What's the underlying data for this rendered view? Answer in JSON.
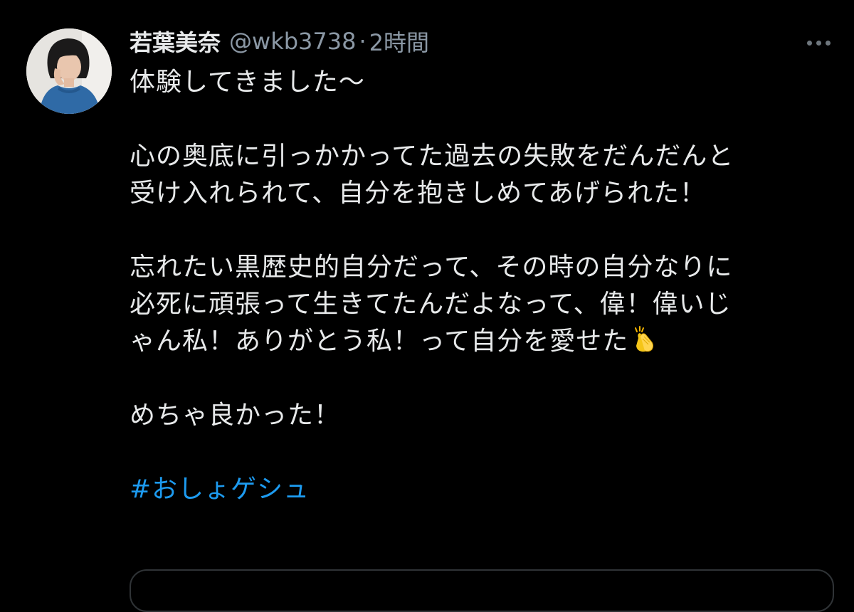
{
  "tweet": {
    "display_name": "若葉美奈",
    "handle": "@wkb3738",
    "separator": "·",
    "time": "2時間",
    "lines": [
      "体験してきました〜",
      "心の奥底に引っかかってた過去の失敗をだんだんと",
      "受け入れられて、自分を抱きしめてあげられた！",
      "忘れたい黒歴史的自分だって、その時の自分なりに",
      "必死に頑張って生きてたんだよなって、偉！偉いじ",
      "ゃん私！ありがとう私！って自分を愛せた",
      "めちゃ良かった！"
    ],
    "hashtag": "#おしょゲシュ",
    "icons": {
      "avatar": "avatar",
      "more": "more-options-icon",
      "clap": "clapping-hands-emoji"
    },
    "colors": {
      "background": "#000000",
      "text": "#e7e9ea",
      "muted": "#8b98a5",
      "link": "#1d9bf0",
      "border": "#2f3336"
    }
  }
}
